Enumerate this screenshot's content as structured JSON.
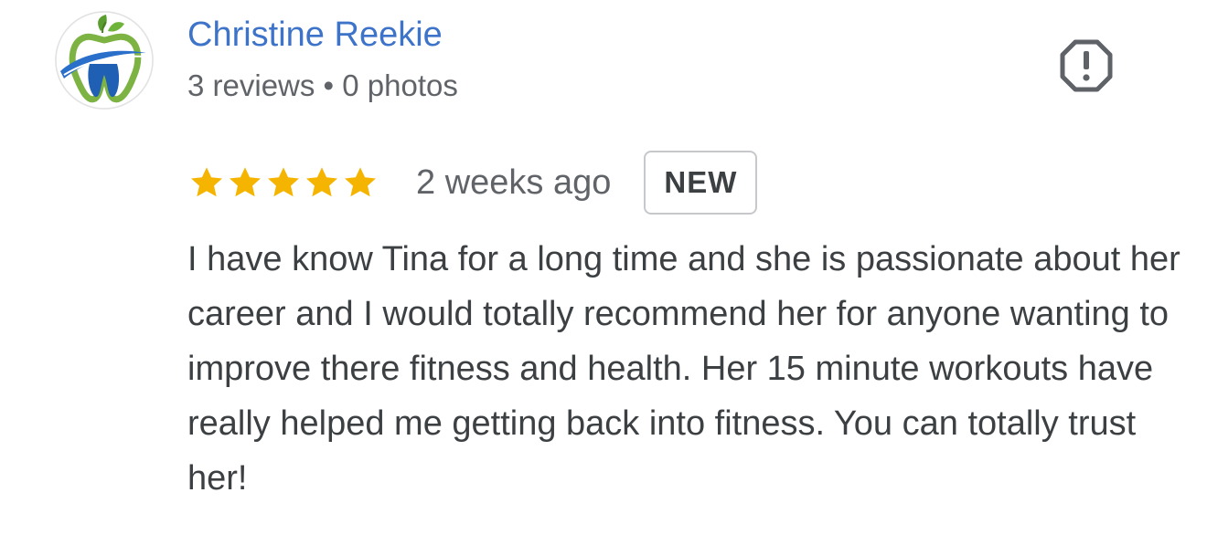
{
  "reviewer": {
    "name": "Christine Reekie",
    "meta": "3 reviews • 0 photos",
    "avatar_icon": "tooth-leaf-logo-icon"
  },
  "actions": {
    "flag_icon": "report-flag-icon"
  },
  "rating": {
    "stars": 5,
    "max_stars": 5,
    "star_color": "#f4b400",
    "time": "2 weeks ago",
    "badge": "NEW"
  },
  "review": {
    "text": "I have know Tina for a long time and she is passionate about her career and I would totally recommend her for anyone wanting to improve there fitness and health. Her 15 minute workouts have really helped me getting back into fitness. You can totally trust her!"
  },
  "colors": {
    "name_link": "#3d73c8",
    "secondary_text": "#606368",
    "body_text": "#3c4043"
  }
}
